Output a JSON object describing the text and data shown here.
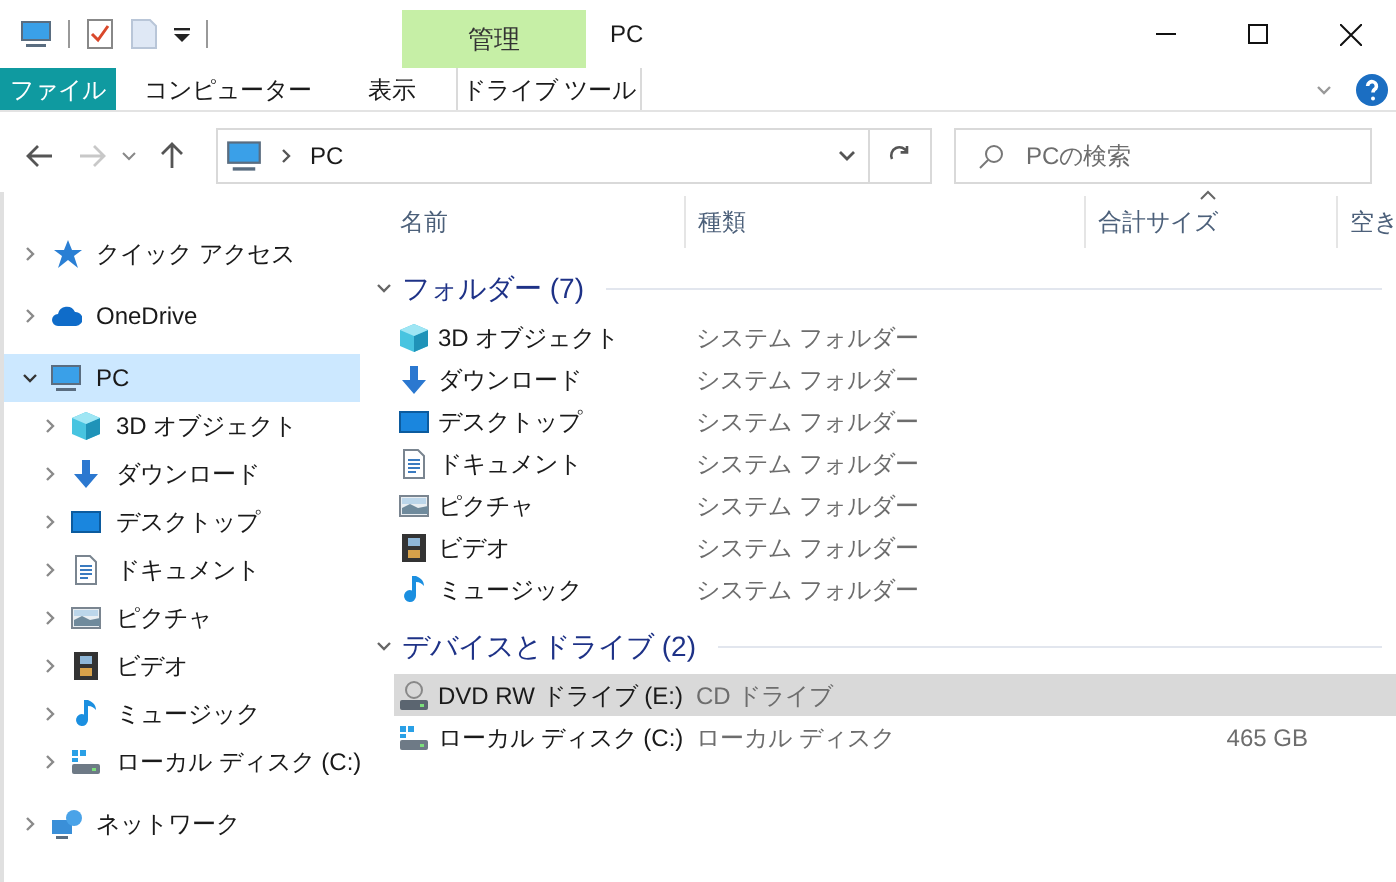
{
  "title_bar": {
    "context_tab": "管理",
    "title": "PC"
  },
  "ribbon": {
    "tabs": [
      {
        "label": "ファイル",
        "kind": "file"
      },
      {
        "label": "コンピューター",
        "kind": "normal"
      },
      {
        "label": "表示",
        "kind": "normal"
      },
      {
        "label": "ドライブ ツール",
        "kind": "context"
      }
    ]
  },
  "address_bar": {
    "back_disabled": false,
    "forward_disabled": true,
    "path": [
      "PC"
    ]
  },
  "search": {
    "placeholder": "PCの検索"
  },
  "navigation": [
    {
      "label": "クイック アクセス",
      "kind": "star",
      "expanded": false,
      "selected": false
    },
    {
      "label": "OneDrive",
      "kind": "cloud",
      "expanded": false,
      "selected": false
    },
    {
      "label": "PC",
      "kind": "pc",
      "expanded": true,
      "selected": true,
      "children": [
        {
          "label": "3D オブジェクト",
          "kind": "cube",
          "expanded": false,
          "selected": false
        },
        {
          "label": "ダウンロード",
          "kind": "download",
          "expanded": false,
          "selected": false
        },
        {
          "label": "デスクトップ",
          "kind": "desktop",
          "expanded": false,
          "selected": false
        },
        {
          "label": "ドキュメント",
          "kind": "document",
          "expanded": false,
          "selected": false
        },
        {
          "label": "ピクチャ",
          "kind": "pictures",
          "expanded": false,
          "selected": false
        },
        {
          "label": "ビデオ",
          "kind": "video",
          "expanded": false,
          "selected": false
        },
        {
          "label": "ミュージック",
          "kind": "music",
          "expanded": false,
          "selected": false
        },
        {
          "label": "ローカル ディスク (C:)",
          "kind": "disk",
          "expanded": false,
          "selected": false
        }
      ]
    },
    {
      "label": "ネットワーク",
      "kind": "network",
      "expanded": false,
      "selected": false
    }
  ],
  "columns": [
    {
      "label": "名前",
      "sorted": false
    },
    {
      "label": "種類",
      "sorted": false
    },
    {
      "label": "合計サイズ",
      "sorted": true
    },
    {
      "label": "空き",
      "sorted": false
    }
  ],
  "groups": [
    {
      "title": "フォルダー (7)",
      "expanded": true,
      "items": [
        {
          "name": "3D オブジェクト",
          "kind": "cube",
          "type": "システム フォルダー",
          "selected": false
        },
        {
          "name": "ダウンロード",
          "kind": "download",
          "type": "システム フォルダー",
          "selected": false
        },
        {
          "name": "デスクトップ",
          "kind": "desktop",
          "type": "システム フォルダー",
          "selected": false
        },
        {
          "name": "ドキュメント",
          "kind": "document",
          "type": "システム フォルダー",
          "selected": false
        },
        {
          "name": "ピクチャ",
          "kind": "pictures",
          "type": "システム フォルダー",
          "selected": false
        },
        {
          "name": "ビデオ",
          "kind": "video",
          "type": "システム フォルダー",
          "selected": false
        },
        {
          "name": "ミュージック",
          "kind": "music",
          "type": "システム フォルダー",
          "selected": false
        }
      ]
    },
    {
      "title": "デバイスとドライブ (2)",
      "expanded": true,
      "items": [
        {
          "name": "DVD RW ドライブ (E:)",
          "kind": "dvd",
          "type": "CD ドライブ",
          "selected": true
        },
        {
          "name": "ローカル ディスク (C:)",
          "kind": "disk",
          "type": "ローカル ディスク",
          "total_size": "465 GB",
          "selected": false
        }
      ]
    }
  ]
}
